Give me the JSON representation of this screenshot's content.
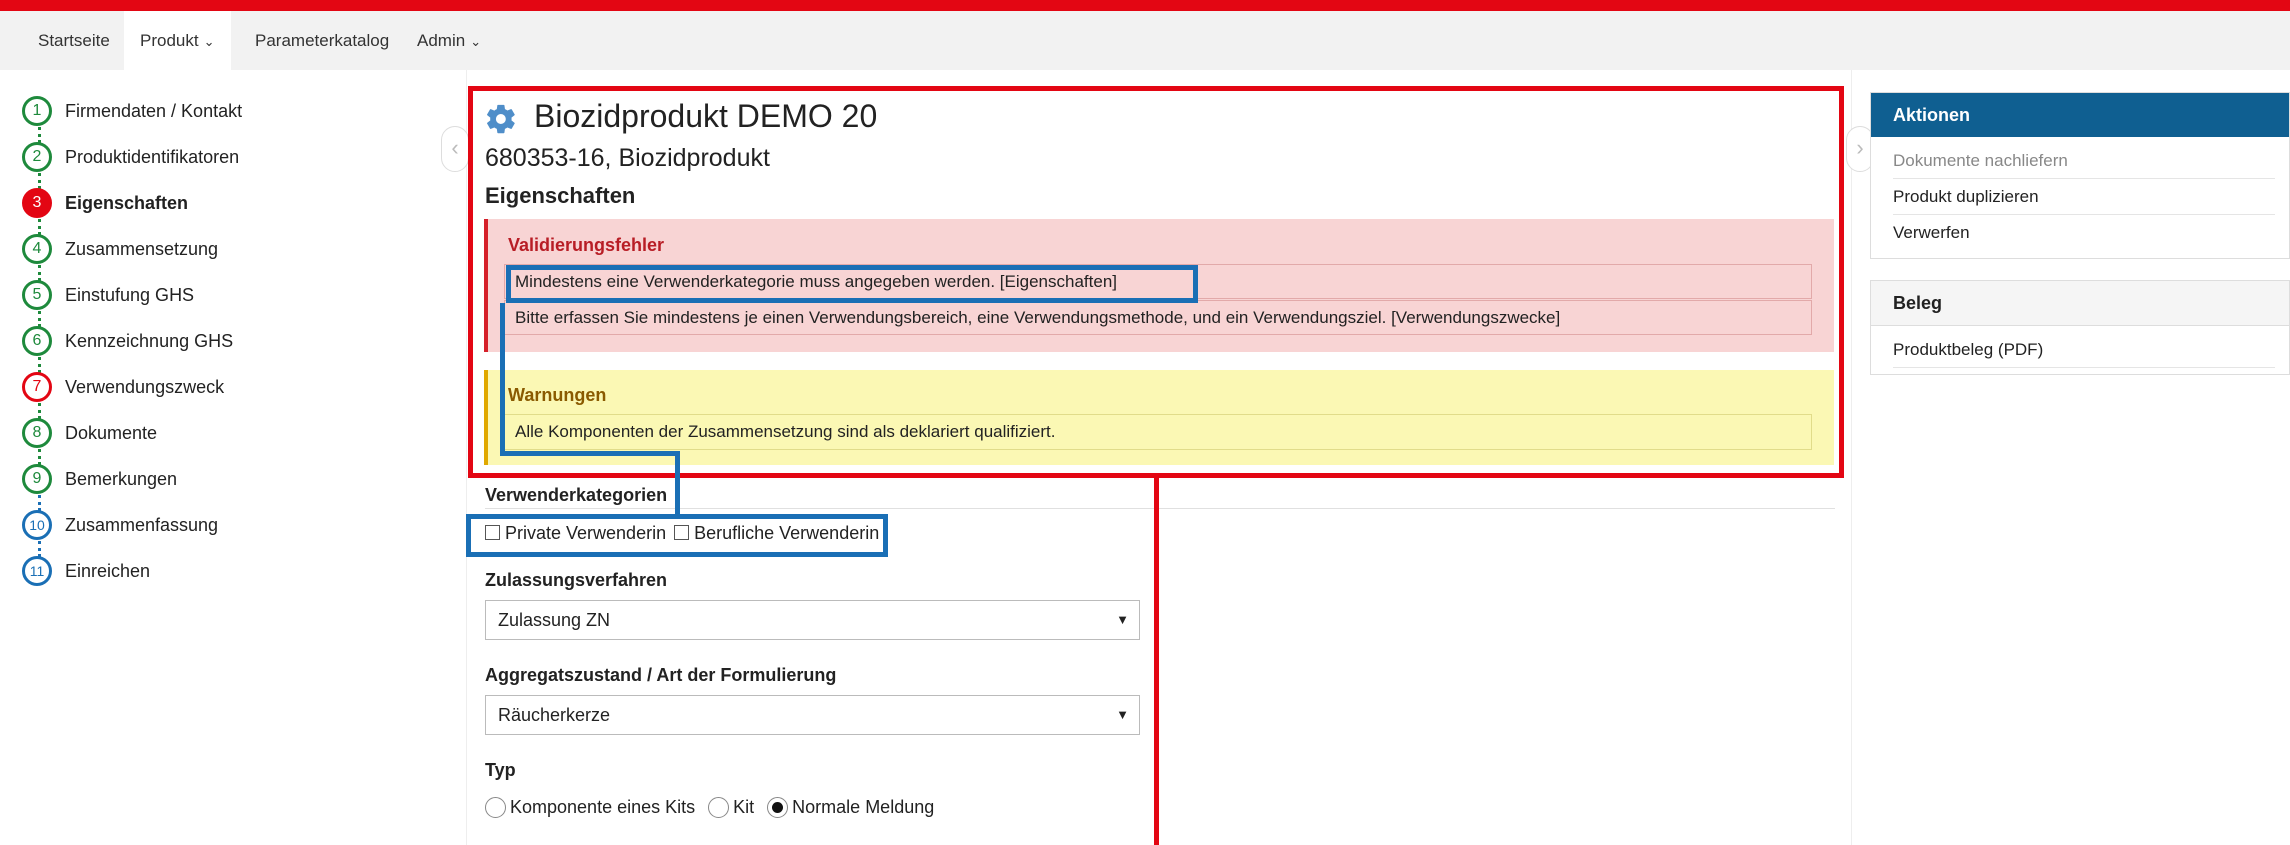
{
  "nav": {
    "items": [
      {
        "label": "Startseite"
      },
      {
        "label": "Produkt"
      },
      {
        "label": "Parameterkatalog"
      },
      {
        "label": "Admin"
      }
    ]
  },
  "steps": [
    {
      "num": "1",
      "label": "Firmendaten / Kontakt"
    },
    {
      "num": "2",
      "label": "Produktidentifikatoren"
    },
    {
      "num": "3",
      "label": "Eigenschaften"
    },
    {
      "num": "4",
      "label": "Zusammensetzung"
    },
    {
      "num": "5",
      "label": "Einstufung GHS"
    },
    {
      "num": "6",
      "label": "Kennzeichnung GHS"
    },
    {
      "num": "7",
      "label": "Verwendungszweck"
    },
    {
      "num": "8",
      "label": "Dokumente"
    },
    {
      "num": "9",
      "label": "Bemerkungen"
    },
    {
      "num": "10",
      "label": "Zusammenfassung"
    },
    {
      "num": "11",
      "label": "Einreichen"
    }
  ],
  "main": {
    "title": "Biozidprodukt DEMO 20",
    "subtitle": "680353-16, Biozidprodukt",
    "section": "Eigenschaften",
    "errors": {
      "heading": "Validierungsfehler",
      "messages": [
        "Mindestens eine Verwenderkategorie muss angegeben werden. [Eigenschaften]",
        "Bitte erfassen Sie mindestens je einen Verwendungsbereich, eine Verwendungsmethode, und ein Verwendungsziel. [Verwendungszwecke]"
      ]
    },
    "warnings": {
      "heading": "Warnungen",
      "messages": [
        "Alle Komponenten der Zusammensetzung sind als deklariert qualifiziert."
      ]
    },
    "verwenderkategorien": {
      "label": "Verwenderkategorien",
      "options": [
        "Private Verwenderin",
        "Berufliche Verwenderin"
      ]
    },
    "zulassungsverfahren": {
      "label": "Zulassungsverfahren",
      "value": "Zulassung ZN"
    },
    "aggregatszustand": {
      "label": "Aggregatszustand / Art der Formulierung",
      "value": "Räucherkerze"
    },
    "typ": {
      "label": "Typ",
      "options": [
        "Komponente eines Kits",
        "Kit",
        "Normale Meldung"
      ],
      "selected": "Normale Meldung"
    }
  },
  "sidebar": {
    "aktionen": {
      "heading": "Aktionen",
      "items": [
        "Dokumente nachliefern",
        "Produkt duplizieren",
        "Verwerfen"
      ]
    },
    "beleg": {
      "heading": "Beleg",
      "items": [
        "Produktbeleg (PDF)"
      ]
    }
  },
  "colors": {
    "accent_red": "#e30613",
    "annotation_blue": "#1a6fb5",
    "step_green": "#1e8a3c",
    "panel_blue": "#0f5f91"
  }
}
